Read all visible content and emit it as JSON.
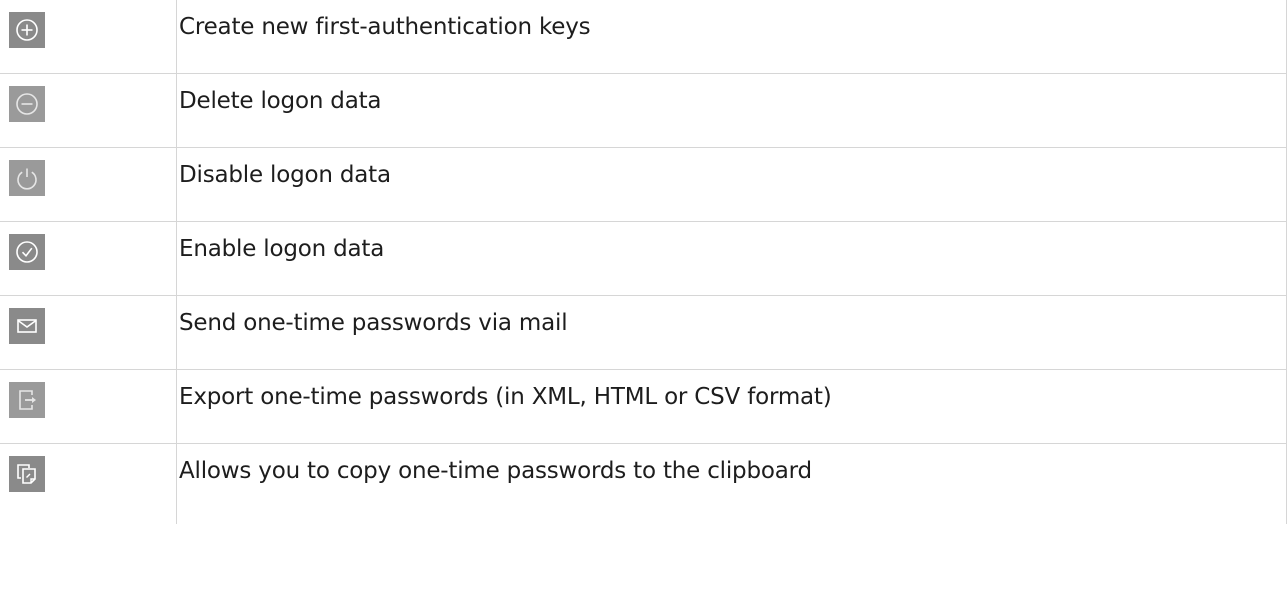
{
  "actions": [
    {
      "icon": "add-circle-icon",
      "label": "Create new first-authentication keys"
    },
    {
      "icon": "remove-circle-icon",
      "label": "Delete logon data"
    },
    {
      "icon": "power-icon",
      "label": "Disable logon data"
    },
    {
      "icon": "check-circle-icon",
      "label": "Enable logon data"
    },
    {
      "icon": "envelope-icon",
      "label": "Send one-time passwords via mail"
    },
    {
      "icon": "export-icon",
      "label": "Export one-time passwords (in XML, HTML or CSV format)"
    },
    {
      "icon": "copy-clipboard-icon",
      "label": "Allows you to copy one-time passwords to the clipboard"
    }
  ]
}
